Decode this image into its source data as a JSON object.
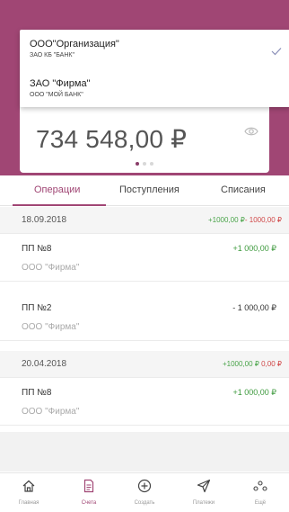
{
  "colors": {
    "brand": "#a04674",
    "positive": "#3e9a3e",
    "negative": "#d04848"
  },
  "accounts": [
    {
      "name": "ООО\"Организация\"",
      "bank": "ЗАО КБ \"БАНК\"",
      "selected": true
    },
    {
      "name": "ЗАО \"Фирма\"",
      "bank": "ООО \"МОЙ БАНК\"",
      "selected": false
    }
  ],
  "balance": {
    "amount": "734 548,00 ₽",
    "icon": "eye-icon"
  },
  "tabs": [
    {
      "label": "Операции",
      "active": true
    },
    {
      "label": "Поступления",
      "active": false
    },
    {
      "label": "Списания",
      "active": false
    }
  ],
  "operations": [
    {
      "date": "18.09.2018",
      "income": "+1000,00 ₽",
      "expense": "- 1000,00 ₽"
    },
    {
      "title": "ПП №8",
      "counterparty": "ООО \"Фирма\"",
      "amount": "+1 000,00 ₽"
    },
    {
      "title": "ПП №2",
      "counterparty": "ООО \"Фирма\"",
      "amount": "- 1 000,00 ₽"
    },
    {
      "date": "20.04.2018",
      "income": "+1000,00 ₽",
      "expense": "0,00 ₽"
    },
    {
      "title": "ПП №8",
      "counterparty": "ООО \"Фирма\"",
      "amount": "+1 000,00 ₽"
    }
  ],
  "bottom_nav": [
    {
      "label": "Главная",
      "icon": "home-icon"
    },
    {
      "label": "Счета",
      "icon": "document-icon",
      "active": true
    },
    {
      "label": "Создать",
      "icon": "plus-circle-icon"
    },
    {
      "label": "Платежи",
      "icon": "paper-plane-icon"
    },
    {
      "label": "Ещё",
      "icon": "more-icon"
    }
  ]
}
